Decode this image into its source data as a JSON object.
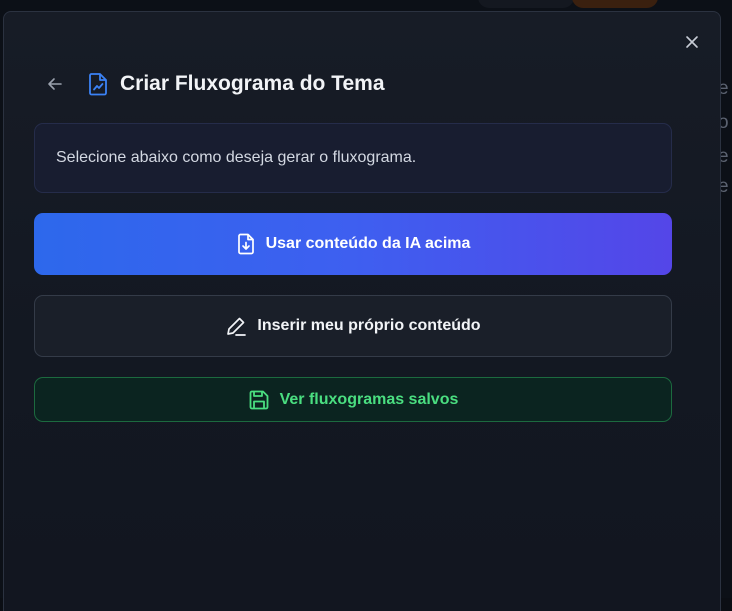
{
  "background": {
    "edge_letters": [
      "e",
      "o",
      "e",
      "e"
    ]
  },
  "modal": {
    "title": "Criar Fluxograma do Tema",
    "info_text": "Selecione abaixo como deseja gerar o fluxograma.",
    "buttons": {
      "use_ai": "Usar conteúdo da IA acima",
      "own_content": "Inserir meu próprio conteúdo",
      "saved": "Ver fluxogramas salvos"
    },
    "icons": {
      "close": "close-icon",
      "back": "arrow-left-icon",
      "title": "file-chart-icon",
      "use_ai": "file-download-icon",
      "own_content": "pencil-icon",
      "saved": "save-icon"
    }
  },
  "colors": {
    "accent_blue": "#3b82f6",
    "gradient_start": "#2d68ec",
    "gradient_end": "#5446e8",
    "success_green": "#4ade80",
    "modal_bg": "#151a24"
  }
}
